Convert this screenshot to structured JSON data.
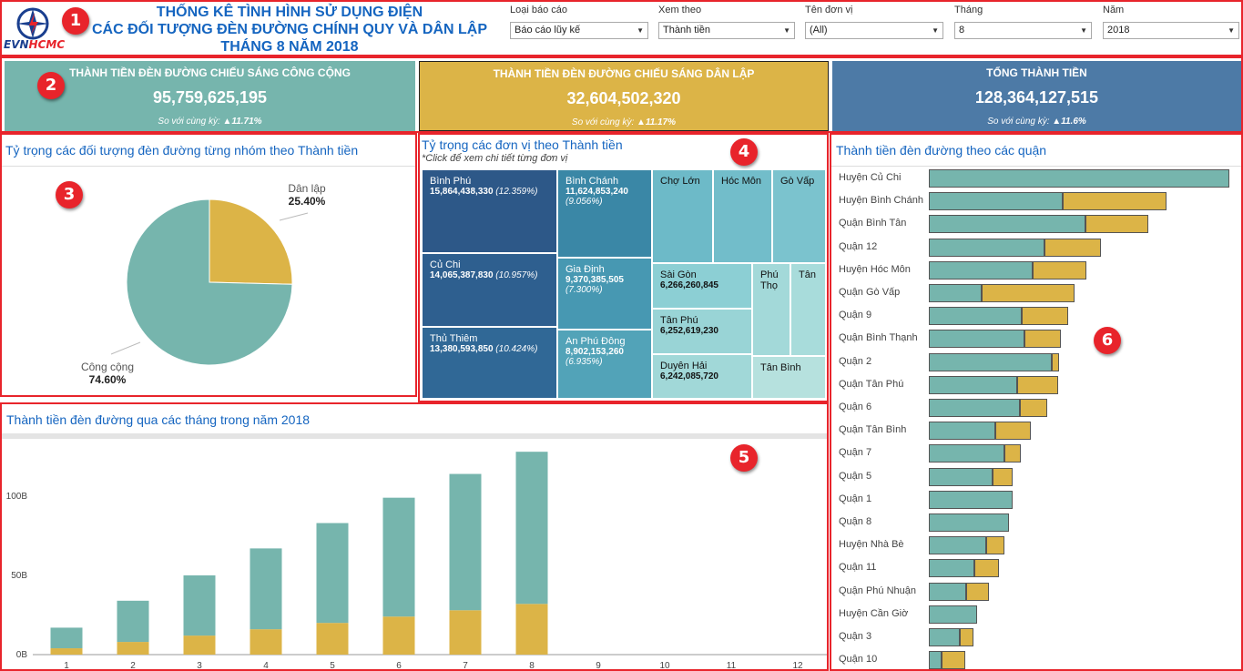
{
  "header": {
    "logo_evn": "EVN",
    "logo_hcm": "HCMC",
    "title_line1": "THỐNG KÊ TÌNH HÌNH SỬ DỤNG ĐIỆN",
    "title_line2": "CÁC ĐỐI TƯỢNG ĐÈN ĐƯỜNG CHÍNH QUY VÀ DÂN LẬP",
    "title_line3": "THÁNG 8 NĂM 2018",
    "filters": [
      {
        "label": "Loại báo cáo",
        "value": "Báo cáo lũy kế"
      },
      {
        "label": "Xem theo",
        "value": "Thành tiền"
      },
      {
        "label": "Tên đơn vị",
        "value": "(All)"
      },
      {
        "label": "Tháng",
        "value": "8"
      },
      {
        "label": "Năm",
        "value": "2018"
      }
    ]
  },
  "badges": [
    "1",
    "2",
    "3",
    "4",
    "5",
    "6"
  ],
  "kpis": [
    {
      "label": "Thành tiền đèn đường chiếu sáng công cộng",
      "value": "95,759,625,195",
      "compare_label": "So với cùng kỳ:",
      "compare_value": "▲11.71%",
      "color": "#76b5ad"
    },
    {
      "label": "Thành tiền đèn đường chiếu sáng dân lập",
      "value": "32,604,502,320",
      "compare_label": "So với cùng kỳ:",
      "compare_value": "▲11.17%",
      "color": "#dcb447"
    },
    {
      "label": "Tổng thành tiền",
      "value": "128,364,127,515",
      "compare_label": "So với cùng kỳ:",
      "compare_value": "▲11.6%",
      "color": "#4d7aa6"
    }
  ],
  "colors": {
    "public": "#76b5ad",
    "private": "#dcb447",
    "total": "#4d7aa6",
    "accent": "#1565c0",
    "highlight": "#e8242b"
  },
  "pie": {
    "title": "Tỷ trọng các đối tượng đèn đường từng nhóm theo Thành tiền",
    "slices": [
      {
        "name": "Dân lập",
        "percent_label": "25.40%",
        "value": 25.4
      },
      {
        "name": "Công cộng",
        "percent_label": "74.60%",
        "value": 74.6
      }
    ]
  },
  "treemap": {
    "title": "Tỷ trọng các đơn vị theo Thành tiền",
    "subtitle": "*Click để xem chi tiết từng đơn vị",
    "cells": [
      {
        "name": "Bình Phú",
        "value": "15,864,438,330",
        "pct": "(12.359%)"
      },
      {
        "name": "Củ Chi",
        "value": "14,065,387,830",
        "pct": "(10.957%)"
      },
      {
        "name": "Thủ Thiêm",
        "value": "13,380,593,850",
        "pct": "(10.424%)"
      },
      {
        "name": "Bình Chánh",
        "value": "11,624,853,240",
        "pct": "(9.056%)"
      },
      {
        "name": "Gia Định",
        "value": "9,370,385,505",
        "pct": "(7.300%)"
      },
      {
        "name": "An Phú Đông",
        "value": "8,902,153,260",
        "pct": "(6.935%)"
      },
      {
        "name": "Chợ Lớn",
        "value": "",
        "pct": ""
      },
      {
        "name": "Hóc Môn",
        "value": "",
        "pct": ""
      },
      {
        "name": "Gò Vấp",
        "value": "",
        "pct": ""
      },
      {
        "name": "Sài Gòn",
        "value": "6,266,260,845",
        "pct": ""
      },
      {
        "name": "Phú Thọ",
        "value": "",
        "pct": ""
      },
      {
        "name": "Tân",
        "value": "",
        "pct": ""
      },
      {
        "name": "Tân Phú",
        "value": "6,252,619,230",
        "pct": ""
      },
      {
        "name": "Duyên Hải",
        "value": "6,242,085,720",
        "pct": ""
      },
      {
        "name": "Tân Bình",
        "value": "",
        "pct": ""
      }
    ]
  },
  "districts": {
    "title": "Thành tiền đèn đường theo các quận",
    "rows": [
      {
        "name": "Huyện Củ Chi",
        "public": 1.0,
        "private": 0.0
      },
      {
        "name": "Huyện Bình Chánh",
        "public": 0.444,
        "private": 0.348
      },
      {
        "name": "Quận Bình Tân",
        "public": 0.52,
        "private": 0.21
      },
      {
        "name": "Quận 12",
        "public": 0.384,
        "private": 0.189
      },
      {
        "name": "Huyện Hóc Môn",
        "public": 0.344,
        "private": 0.18
      },
      {
        "name": "Quận Gò Vấp",
        "public": 0.177,
        "private": 0.308
      },
      {
        "name": "Quận 9",
        "public": 0.308,
        "private": 0.155
      },
      {
        "name": "Quận Bình Thạnh",
        "public": 0.317,
        "private": 0.122
      },
      {
        "name": "Quận 2",
        "public": 0.409,
        "private": 0.024
      },
      {
        "name": "Quận Tân Phú",
        "public": 0.293,
        "private": 0.137
      },
      {
        "name": "Quận 6",
        "public": 0.302,
        "private": 0.091
      },
      {
        "name": "Quận Tân Bình",
        "public": 0.22,
        "private": 0.119
      },
      {
        "name": "Quận 7",
        "public": 0.25,
        "private": 0.055
      },
      {
        "name": "Quận 5",
        "public": 0.213,
        "private": 0.067
      },
      {
        "name": "Quận 1",
        "public": 0.28,
        "private": 0.0
      },
      {
        "name": "Quận 8",
        "public": 0.268,
        "private": 0.0
      },
      {
        "name": "Huyện Nhà Bè",
        "public": 0.192,
        "private": 0.061
      },
      {
        "name": "Quận 11",
        "public": 0.152,
        "private": 0.082
      },
      {
        "name": "Quận Phú Nhuận",
        "public": 0.125,
        "private": 0.076
      },
      {
        "name": "Huyện Cần Giờ",
        "public": 0.162,
        "private": 0.0
      },
      {
        "name": "Quận 3",
        "public": 0.104,
        "private": 0.046
      },
      {
        "name": "Quận 10",
        "public": 0.043,
        "private": 0.079
      }
    ]
  },
  "chart_data": {
    "type": "bar",
    "title": "Thành tiền đèn đường qua các tháng trong năm 2018",
    "categories": [
      "1",
      "2",
      "3",
      "4",
      "5",
      "6",
      "7",
      "8",
      "9",
      "10",
      "11",
      "12"
    ],
    "series": [
      {
        "name": "Công công",
        "values": [
          13,
          26,
          38,
          51,
          63,
          75,
          86,
          96,
          null,
          null,
          null,
          null
        ]
      },
      {
        "name": "Dân lập",
        "values": [
          4,
          8,
          12,
          16,
          20,
          24,
          28,
          32,
          null,
          null,
          null,
          null
        ]
      }
    ],
    "yticks": [
      {
        "value": 0,
        "label": "0B"
      },
      {
        "value": 50,
        "label": "50B"
      },
      {
        "value": 100,
        "label": "100B"
      }
    ],
    "ylim": [
      0,
      135
    ],
    "stacked": true,
    "grid": false
  }
}
